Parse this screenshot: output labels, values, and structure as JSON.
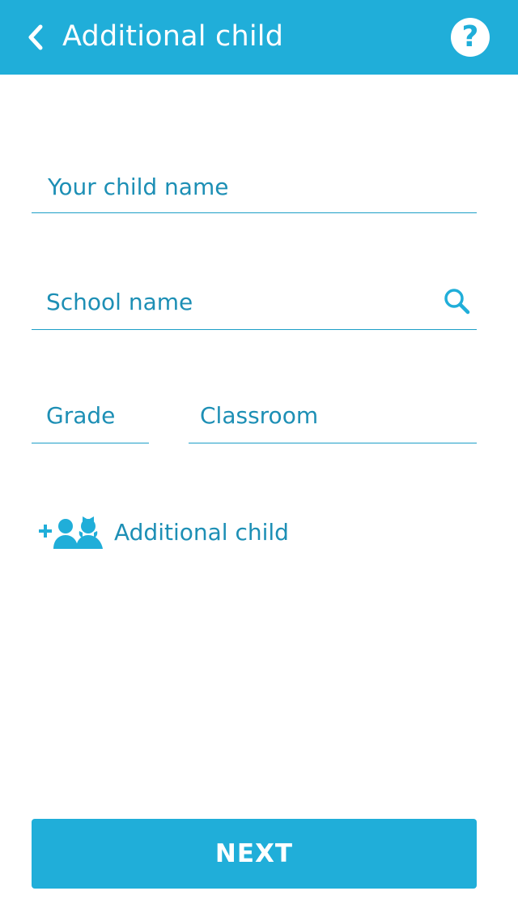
{
  "header": {
    "title": "Additional child",
    "back_icon": "chevron-left-icon",
    "help_icon": "question-mark-icon",
    "help_glyph": "?"
  },
  "form": {
    "child_name": {
      "value": "",
      "placeholder": "Your child name"
    },
    "school_name": {
      "value": "",
      "placeholder": "School name",
      "icon": "search-icon"
    },
    "grade": {
      "value": "",
      "placeholder": "Grade"
    },
    "classroom": {
      "value": "",
      "placeholder": "Classroom"
    }
  },
  "add_child": {
    "label": "Additional child",
    "icon": "add-children-icon"
  },
  "next_button": {
    "label": "NEXT"
  },
  "colors": {
    "accent": "#20aed9",
    "text_accent": "#1d8fb5",
    "background": "#ffffff"
  }
}
